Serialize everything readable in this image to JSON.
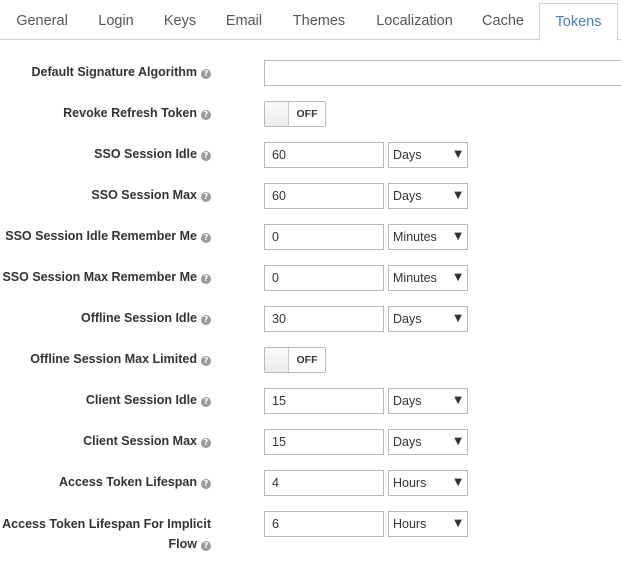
{
  "tabs": [
    {
      "label": "General"
    },
    {
      "label": "Login"
    },
    {
      "label": "Keys"
    },
    {
      "label": "Email"
    },
    {
      "label": "Themes"
    },
    {
      "label": "Localization"
    },
    {
      "label": "Cache"
    },
    {
      "label": "Tokens",
      "active": true
    }
  ],
  "form": {
    "default_signature_algorithm": {
      "label": "Default Signature Algorithm",
      "value": ""
    },
    "revoke_refresh_token": {
      "label": "Revoke Refresh Token",
      "state": "OFF"
    },
    "sso_session_idle": {
      "label": "SSO Session Idle",
      "value": "60",
      "unit": "Days"
    },
    "sso_session_max": {
      "label": "SSO Session Max",
      "value": "60",
      "unit": "Days"
    },
    "sso_session_idle_remember_me": {
      "label": "SSO Session Idle Remember Me",
      "value": "0",
      "unit": "Minutes"
    },
    "sso_session_max_remember_me": {
      "label": "SSO Session Max Remember Me",
      "value": "0",
      "unit": "Minutes"
    },
    "offline_session_idle": {
      "label": "Offline Session Idle",
      "value": "30",
      "unit": "Days"
    },
    "offline_session_max_limited": {
      "label": "Offline Session Max Limited",
      "state": "OFF"
    },
    "client_session_idle": {
      "label": "Client Session Idle",
      "value": "15",
      "unit": "Days"
    },
    "client_session_max": {
      "label": "Client Session Max",
      "value": "15",
      "unit": "Days"
    },
    "access_token_lifespan": {
      "label": "Access Token Lifespan",
      "value": "4",
      "unit": "Hours"
    },
    "access_token_lifespan_implicit": {
      "label_line1": "Access Token Lifespan For Implicit",
      "label_line2": "Flow",
      "value": "6",
      "unit": "Hours"
    }
  },
  "help_icon": "question-circle-icon",
  "colors": {
    "active_tab": "#4a7fc0",
    "border": "#d1d1d1"
  }
}
